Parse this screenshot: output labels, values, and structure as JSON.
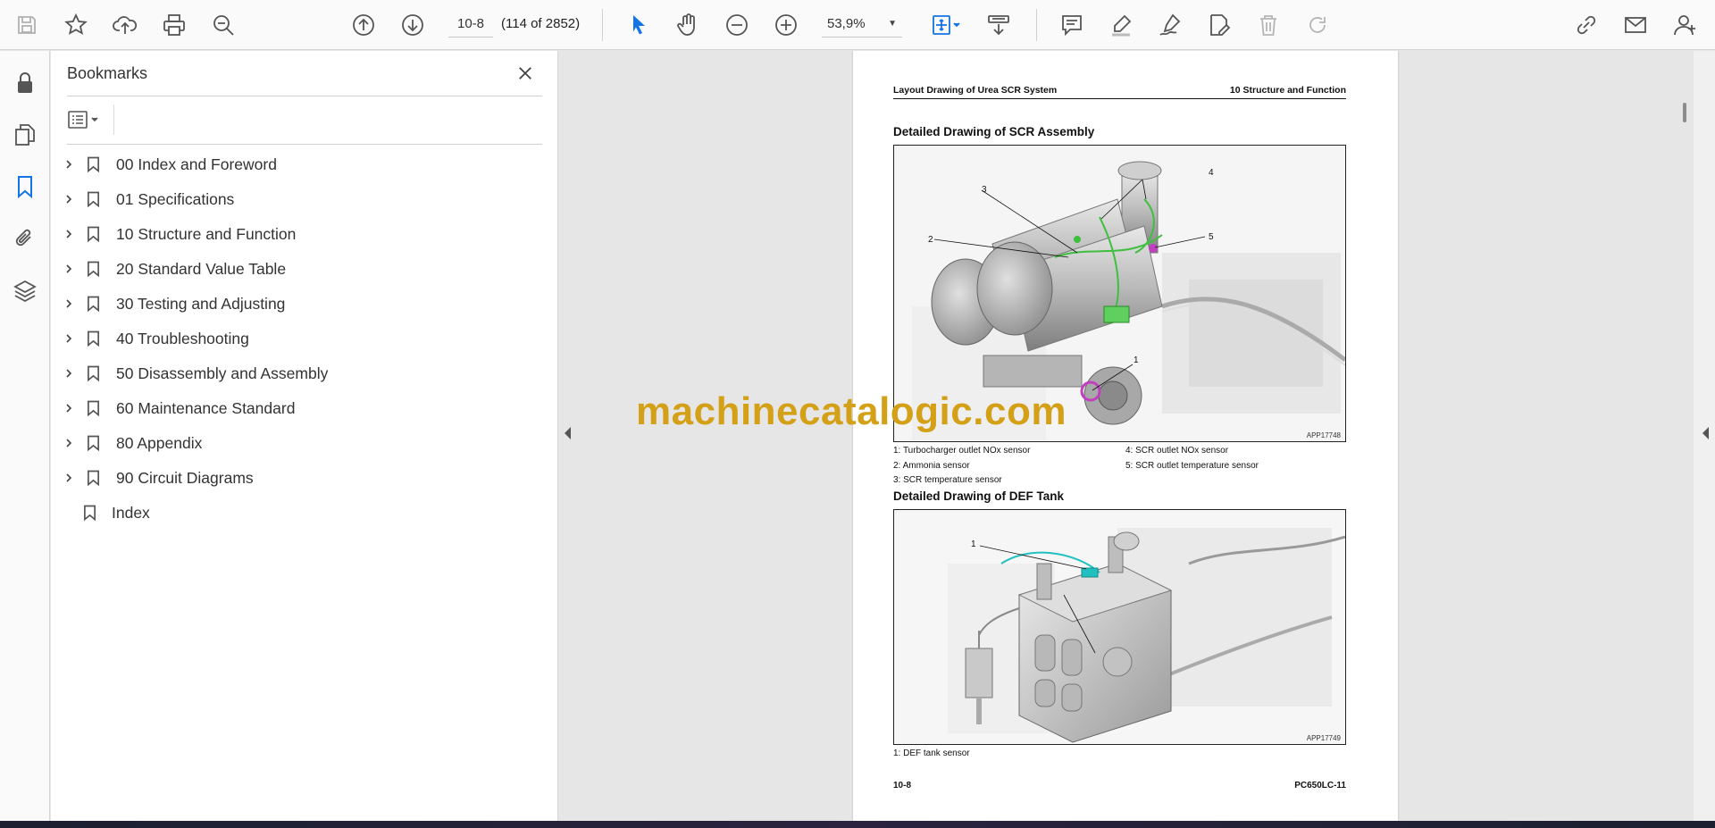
{
  "toolbar": {
    "page_number": "10-8",
    "page_count": "(114 of 2852)",
    "zoom": "53,9%",
    "icons": [
      "save-icon",
      "bookmark-star-icon",
      "upload-icon",
      "print-icon",
      "zoom-search-icon",
      "page-up-icon",
      "page-down-icon",
      "select-cursor-icon",
      "hand-icon",
      "zoom-out-icon",
      "zoom-in-icon",
      "zoom-dropdown-icon",
      "fit-page-icon",
      "scroll-mode-icon",
      "comment-icon",
      "highlight-icon",
      "draw-icon",
      "edit-sign-icon",
      "delete-icon",
      "redo-icon",
      "share-link-icon",
      "email-icon",
      "account-icon"
    ]
  },
  "rail": {
    "icons": [
      "lock-icon",
      "pages-icon",
      "bookmark-icon",
      "attachment-icon",
      "layers-icon"
    ]
  },
  "bookmarks": {
    "title": "Bookmarks",
    "items": [
      {
        "label": "00 Index and Foreword",
        "expandable": true
      },
      {
        "label": "01 Specifications",
        "expandable": true
      },
      {
        "label": "10 Structure and Function",
        "expandable": true
      },
      {
        "label": "20 Standard Value Table",
        "expandable": true
      },
      {
        "label": "30 Testing and Adjusting",
        "expandable": true
      },
      {
        "label": "40 Troubleshooting",
        "expandable": true
      },
      {
        "label": "50 Disassembly and Assembly",
        "expandable": true
      },
      {
        "label": "60 Maintenance Standard",
        "expandable": true
      },
      {
        "label": "80 Appendix",
        "expandable": true
      },
      {
        "label": "90 Circuit Diagrams",
        "expandable": true
      },
      {
        "label": "Index",
        "expandable": false
      }
    ]
  },
  "page": {
    "header_left": "Layout Drawing of Urea SCR System",
    "header_right": "10 Structure and Function",
    "section1_title": "Detailed Drawing of SCR Assembly",
    "figure1_code": "APP17748",
    "figure1_callouts": [
      "1",
      "2",
      "3",
      "4",
      "5"
    ],
    "figure1_legend": {
      "col1": [
        "1: Turbocharger outlet NOx sensor",
        "2: Ammonia sensor",
        "3: SCR temperature sensor"
      ],
      "col2": [
        "4: SCR outlet NOx sensor",
        "5: SCR outlet temperature sensor"
      ]
    },
    "section2_title": "Detailed Drawing of DEF Tank",
    "figure2_code": "APP17749",
    "figure2_callouts": [
      "1"
    ],
    "figure2_legend": [
      "1: DEF tank sensor"
    ],
    "footer_left": "10-8",
    "footer_right": "PC650LC-11"
  },
  "watermark": "machinecatalogic.com",
  "colors": {
    "accent_blue": "#1473e6",
    "watermark_gold": "#d4a017",
    "sensor_green": "#3fbf3f",
    "sensor_magenta": "#c040c0",
    "sensor_cyan": "#20c0c0"
  }
}
